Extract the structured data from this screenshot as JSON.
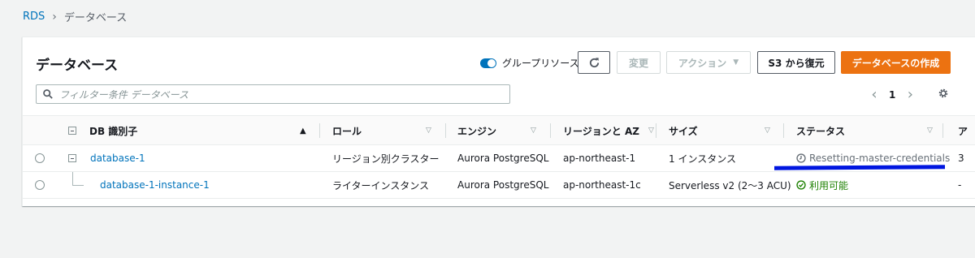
{
  "breadcrumb": {
    "root": "RDS",
    "current": "データベース"
  },
  "panel": {
    "title": "データベース",
    "toggle_label": "グループリソース",
    "buttons": {
      "modify": "変更",
      "actions": "アクション",
      "restore": "S3 から復元",
      "create": "データベースの作成"
    },
    "search_placeholder": "フィルター条件 データベース",
    "page_number": "1"
  },
  "table": {
    "headers": {
      "db_id": "DB 識別子",
      "role": "ロール",
      "engine": "エンジン",
      "region": "リージョンと AZ",
      "size": "サイズ",
      "status": "ステータス",
      "overflow": "ア"
    },
    "rows": [
      {
        "db_id": "database-1",
        "role": "リージョン別クラスター",
        "engine": "Aurora PostgreSQL",
        "region": "ap-northeast-1",
        "size": "1 インスタンス",
        "status": "Resetting-master-credentials",
        "overflow": "3"
      },
      {
        "db_id": "database-1-instance-1",
        "role": "ライターインスタンス",
        "engine": "Aurora PostgreSQL",
        "region": "ap-northeast-1c",
        "size": "Serverless v2 (2〜3 ACU)",
        "status": "利用可能",
        "overflow": "-"
      }
    ]
  },
  "colors": {
    "link": "#0073bb",
    "primary_button": "#ec7211",
    "status_available": "#1d8102",
    "annotation_line": "#0016e0"
  },
  "icons": [
    "chevron-right-icon",
    "refresh-icon",
    "caret-down-icon",
    "search-icon",
    "chevron-left-icon",
    "gear-icon",
    "sort-desc-icon",
    "sort-icon",
    "clock-icon",
    "check-circle-icon"
  ]
}
